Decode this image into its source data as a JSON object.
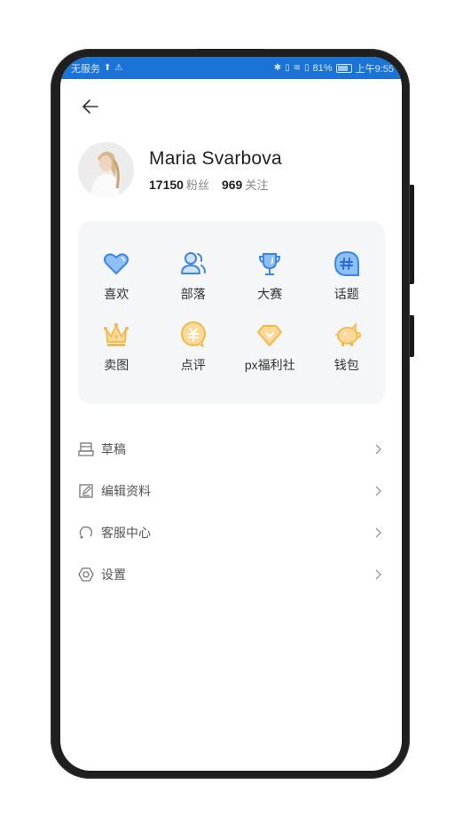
{
  "status_bar": {
    "carrier": "无服务",
    "battery_percent": "81%",
    "time": "上午9:55",
    "icons": [
      "upload-icon",
      "warning-icon",
      "bluetooth-icon",
      "vibrate-icon",
      "wifi-icon",
      "sim-icon",
      "battery-icon"
    ]
  },
  "header": {
    "back_icon": "arrow-left-icon"
  },
  "profile": {
    "name": "Maria Svarbova",
    "followers_count": "17150",
    "followers_label": "粉丝",
    "following_count": "969",
    "following_label": "关注"
  },
  "grid": {
    "items": [
      {
        "label": "喜欢",
        "icon": "heart-icon",
        "color": "#5b9cf0"
      },
      {
        "label": "部落",
        "icon": "users-icon",
        "color": "#5b9cf0"
      },
      {
        "label": "大赛",
        "icon": "trophy-icon",
        "color": "#5b9cf0"
      },
      {
        "label": "话题",
        "icon": "hashtag-icon",
        "color": "#5b9cf0"
      },
      {
        "label": "卖图",
        "icon": "crown-icon",
        "color": "#f7c86a"
      },
      {
        "label": "点评",
        "icon": "yuan-coin-icon",
        "color": "#f7c86a"
      },
      {
        "label": "px福利社",
        "icon": "diamond-icon",
        "color": "#f7c86a"
      },
      {
        "label": "钱包",
        "icon": "piggy-bank-icon",
        "color": "#f7c86a"
      }
    ]
  },
  "menu": {
    "items": [
      {
        "label": "草稿",
        "icon": "drafts-icon"
      },
      {
        "label": "编辑资料",
        "icon": "edit-icon"
      },
      {
        "label": "客服中心",
        "icon": "headset-icon"
      },
      {
        "label": "设置",
        "icon": "settings-icon"
      }
    ]
  }
}
